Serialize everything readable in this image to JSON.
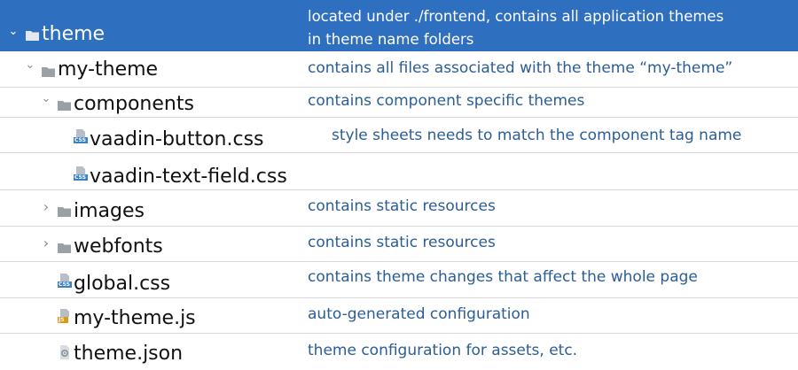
{
  "rows": [
    {
      "name": "theme",
      "desc": "located under ./frontend, contains all application themes",
      "desc2": "in theme name folders",
      "icon": "folder-icon",
      "toggle": "expanded"
    },
    {
      "name": "my-theme",
      "desc": "contains all files associated with the theme “my-theme”",
      "icon": "folder-icon",
      "toggle": "expanded"
    },
    {
      "name": "components",
      "desc": "contains component specific themes",
      "icon": "folder-icon",
      "toggle": "expanded"
    },
    {
      "name": "vaadin-button.css",
      "desc": "style sheets needs to match the component tag name",
      "icon": "css-file-icon",
      "badge": "CSS"
    },
    {
      "name": "vaadin-text-field.css",
      "desc": "",
      "icon": "css-file-icon",
      "badge": "CSS"
    },
    {
      "name": "images",
      "desc": "contains static resources",
      "icon": "folder-icon",
      "toggle": "collapsed"
    },
    {
      "name": "webfonts",
      "desc": "contains static resources",
      "icon": "folder-icon",
      "toggle": "collapsed"
    },
    {
      "name": "global.css",
      "desc": "contains theme changes that affect the whole page",
      "icon": "css-file-icon",
      "badge": "CSS"
    },
    {
      "name": "my-theme.js",
      "desc": "auto-generated configuration",
      "icon": "js-file-icon",
      "badge": "JS"
    },
    {
      "name": "theme.json",
      "desc": "theme configuration for assets, etc.",
      "icon": "json-file-icon"
    }
  ],
  "colors": {
    "selection": "#2f6fbf",
    "description": "#2b5d96",
    "folder": "#9aa0a6",
    "css_badge": "#3b82c4",
    "js_badge": "#d99a1c"
  }
}
